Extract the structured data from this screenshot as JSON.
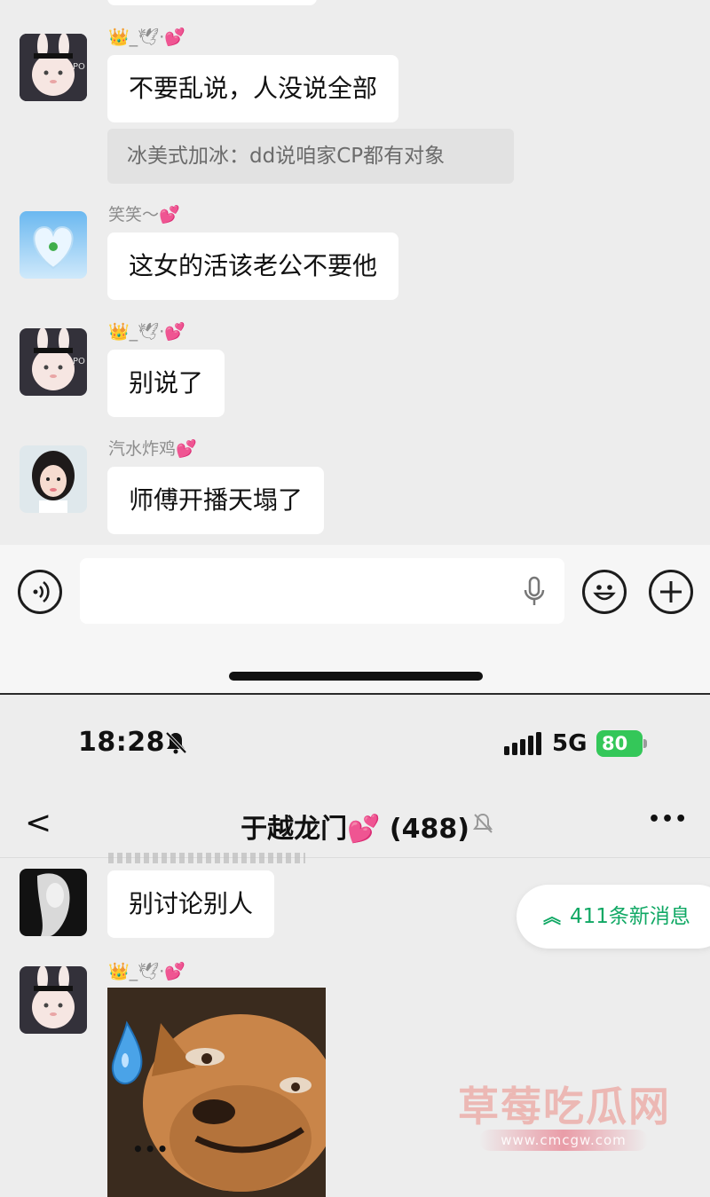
{
  "top_chat": {
    "messages": [
      {
        "sender": "👑_🕊·💕",
        "text": "不要乱说，人没说全部",
        "quote": "冰美式加冰：dd说咱家CP都有对象"
      },
      {
        "sender": "笑笑～💕",
        "text": "这女的活该老公不要他"
      },
      {
        "sender": "👑_🕊·💕",
        "text": "别说了"
      },
      {
        "sender": "汽水炸鸡💕",
        "text": "师傅开播天塌了"
      }
    ]
  },
  "status_bar": {
    "time": "18:28",
    "network": "5G",
    "battery": "80"
  },
  "nav": {
    "title": "于越龙门💕 (488)",
    "back": "<",
    "more": "•••"
  },
  "new_messages_pill": "411条新消息",
  "bottom_chat": {
    "messages": [
      {
        "text": "别讨论别人"
      },
      {
        "sender": "👑_🕊·💕",
        "sticker_caption": "•••"
      }
    ]
  },
  "watermark": {
    "title": "草莓吃瓜网",
    "url": "www.cmcgw.com"
  },
  "colors": {
    "chat_bg": "#ededed",
    "bubble_bg": "#ffffff",
    "accent_green": "#10a864",
    "heart_pink": "#ff4fa3",
    "battery_green": "#34c759"
  }
}
